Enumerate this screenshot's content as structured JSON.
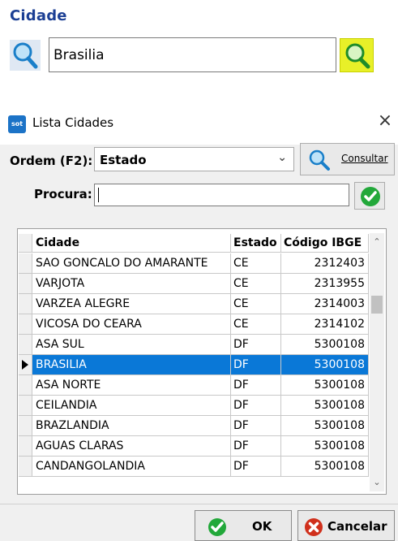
{
  "field": {
    "title": "Cidade",
    "value": "Brasilia"
  },
  "dialog": {
    "app_icon_text": "sot",
    "title": "Lista Cidades",
    "close": "×",
    "ordem_label": "Ordem (F2):",
    "ordem_value": "Estado",
    "consultar_label": "Consultar",
    "procura_label": "Procura:",
    "procura_value": ""
  },
  "grid": {
    "columns": [
      "Cidade",
      "Estado",
      "Código IBGE"
    ],
    "rows": [
      {
        "cidade": "SAO GONCALO DO AMARANTE",
        "estado": "CE",
        "ibge": "2312403"
      },
      {
        "cidade": "VARJOTA",
        "estado": "CE",
        "ibge": "2313955"
      },
      {
        "cidade": "VARZEA ALEGRE",
        "estado": "CE",
        "ibge": "2314003"
      },
      {
        "cidade": "VICOSA DO CEARA",
        "estado": "CE",
        "ibge": "2314102"
      },
      {
        "cidade": "ASA SUL",
        "estado": "DF",
        "ibge": "5300108"
      },
      {
        "cidade": "BRASILIA",
        "estado": "DF",
        "ibge": "5300108"
      },
      {
        "cidade": "ASA NORTE",
        "estado": "DF",
        "ibge": "5300108"
      },
      {
        "cidade": "CEILANDIA",
        "estado": "DF",
        "ibge": "5300108"
      },
      {
        "cidade": "BRAZLANDIA",
        "estado": "DF",
        "ibge": "5300108"
      },
      {
        "cidade": "AGUAS CLARAS",
        "estado": "DF",
        "ibge": "5300108"
      },
      {
        "cidade": "CANDANGOLANDIA",
        "estado": "DF",
        "ibge": "5300108"
      }
    ]
  },
  "buttons": {
    "ok": "OK",
    "cancel": "Cancelar"
  },
  "colors": {
    "title_blue": "#1c3f94",
    "selection": "#0a78d7",
    "highlight_yellow": "#e8f028",
    "ok_green": "#22a83a",
    "cancel_red": "#d0301c"
  }
}
